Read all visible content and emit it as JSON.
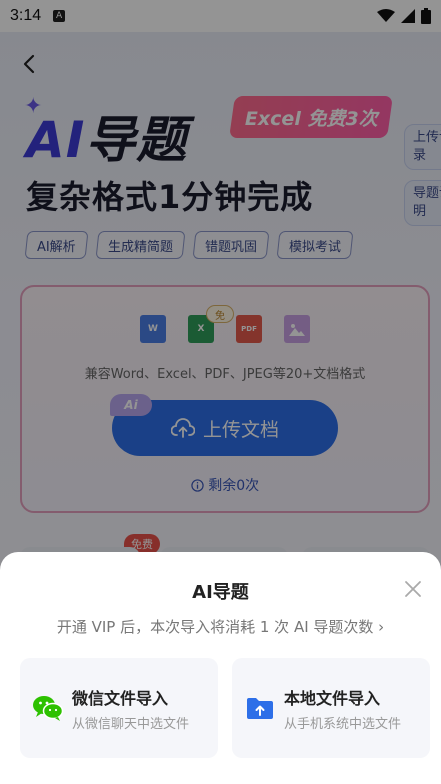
{
  "status_bar": {
    "time": "3:14",
    "notification_badge": "A"
  },
  "header": {
    "hero_ai": "AI",
    "hero_rest": "导题",
    "promo_tag": "Excel 免费3次",
    "subtitle": "复杂格式1分钟完成",
    "side_buttons": [
      "上传记录",
      "导题说明"
    ]
  },
  "features": [
    "AI解析",
    "生成精简题",
    "错题巩固",
    "模拟考试"
  ],
  "upload_card": {
    "file_types": [
      "W",
      "X",
      "PDF",
      "image"
    ],
    "free_tag": "免",
    "compat_text": "兼容Word、Excel、PDF、JPEG等20+文档格式",
    "ai_chip": "Ai",
    "upload_button": "上传文档",
    "remaining": "剩余0次"
  },
  "below_badge": "免费",
  "sheet": {
    "title": "AI导题",
    "tip": "开通 VIP 后，本次导入将消耗 1 次 AI 导题次数 ›",
    "options": [
      {
        "title": "微信文件导入",
        "subtitle": "从微信聊天中选文件",
        "icon": "wechat-icon"
      },
      {
        "title": "本地文件导入",
        "subtitle": "从手机系统中选文件",
        "icon": "folder-upload-icon"
      }
    ]
  },
  "colors": {
    "primary": "#2d6fe8",
    "accent_pink": "#ff5fa8",
    "wechat_green": "#2dc100"
  }
}
